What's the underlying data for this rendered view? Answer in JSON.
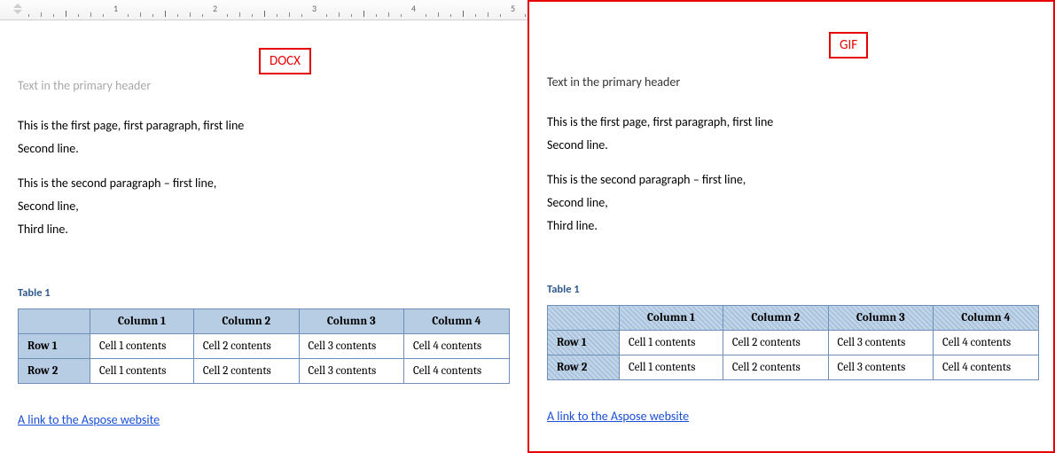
{
  "formats": {
    "docx": "DOCX",
    "gif": "GIF"
  },
  "ruler_numbers": [
    "1",
    "2",
    "3",
    "4",
    "5"
  ],
  "header_text": "Text in the primary header",
  "para1_line1": "This is the first page, first paragraph, first line",
  "para1_line2": "Second line.",
  "para2_line1": "This is the second paragraph – first line,",
  "para2_line2": "Second line,",
  "para2_line3": "Third line.",
  "table_caption": "Table 1",
  "table": {
    "columns": [
      "Column 1",
      "Column 2",
      "Column 3",
      "Column 4"
    ],
    "rows": [
      {
        "hdr": "Row 1",
        "cells": [
          "Cell 1 contents",
          "Cell 2 contents",
          "Cell 3 contents",
          "Cell 4 contents"
        ]
      },
      {
        "hdr": "Row 2",
        "cells": [
          "Cell 1 contents",
          "Cell 2 contents",
          "Cell 3 contents",
          "Cell 4 contents"
        ]
      }
    ]
  },
  "link_text": "A link to the Aspose website"
}
